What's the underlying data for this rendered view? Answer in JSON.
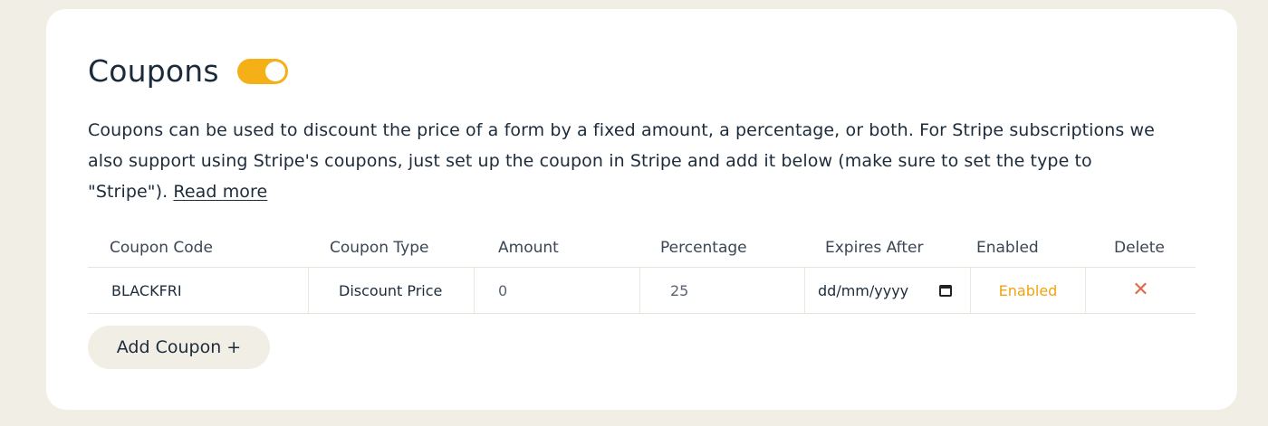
{
  "section": {
    "title": "Coupons",
    "enabled_toggle": true,
    "description": "Coupons can be used to discount the price of a form by a fixed amount, a percentage, or both. For Stripe subscriptions we also support using Stripe's coupons, just set up the coupon in Stripe and add it below (make sure to set the type to \"Stripe\"). ",
    "read_more_label": "Read more"
  },
  "table": {
    "columns": [
      "Coupon Code",
      "Coupon Type",
      "Amount",
      "Percentage",
      "Expires After",
      "Enabled",
      "Delete"
    ],
    "rows": [
      {
        "code": "BLACKFRI",
        "type": "Discount Price",
        "amount": "0",
        "percentage": "25",
        "expires": "dd/mm/yyyy",
        "enabled": "Enabled",
        "delete_icon": "close-icon"
      }
    ]
  },
  "actions": {
    "add_coupon_label": "Add Coupon +"
  },
  "colors": {
    "accent": "#f5b017",
    "enabled_text": "#f0a30f",
    "delete": "#e06a4e",
    "background": "#f1eee6"
  }
}
